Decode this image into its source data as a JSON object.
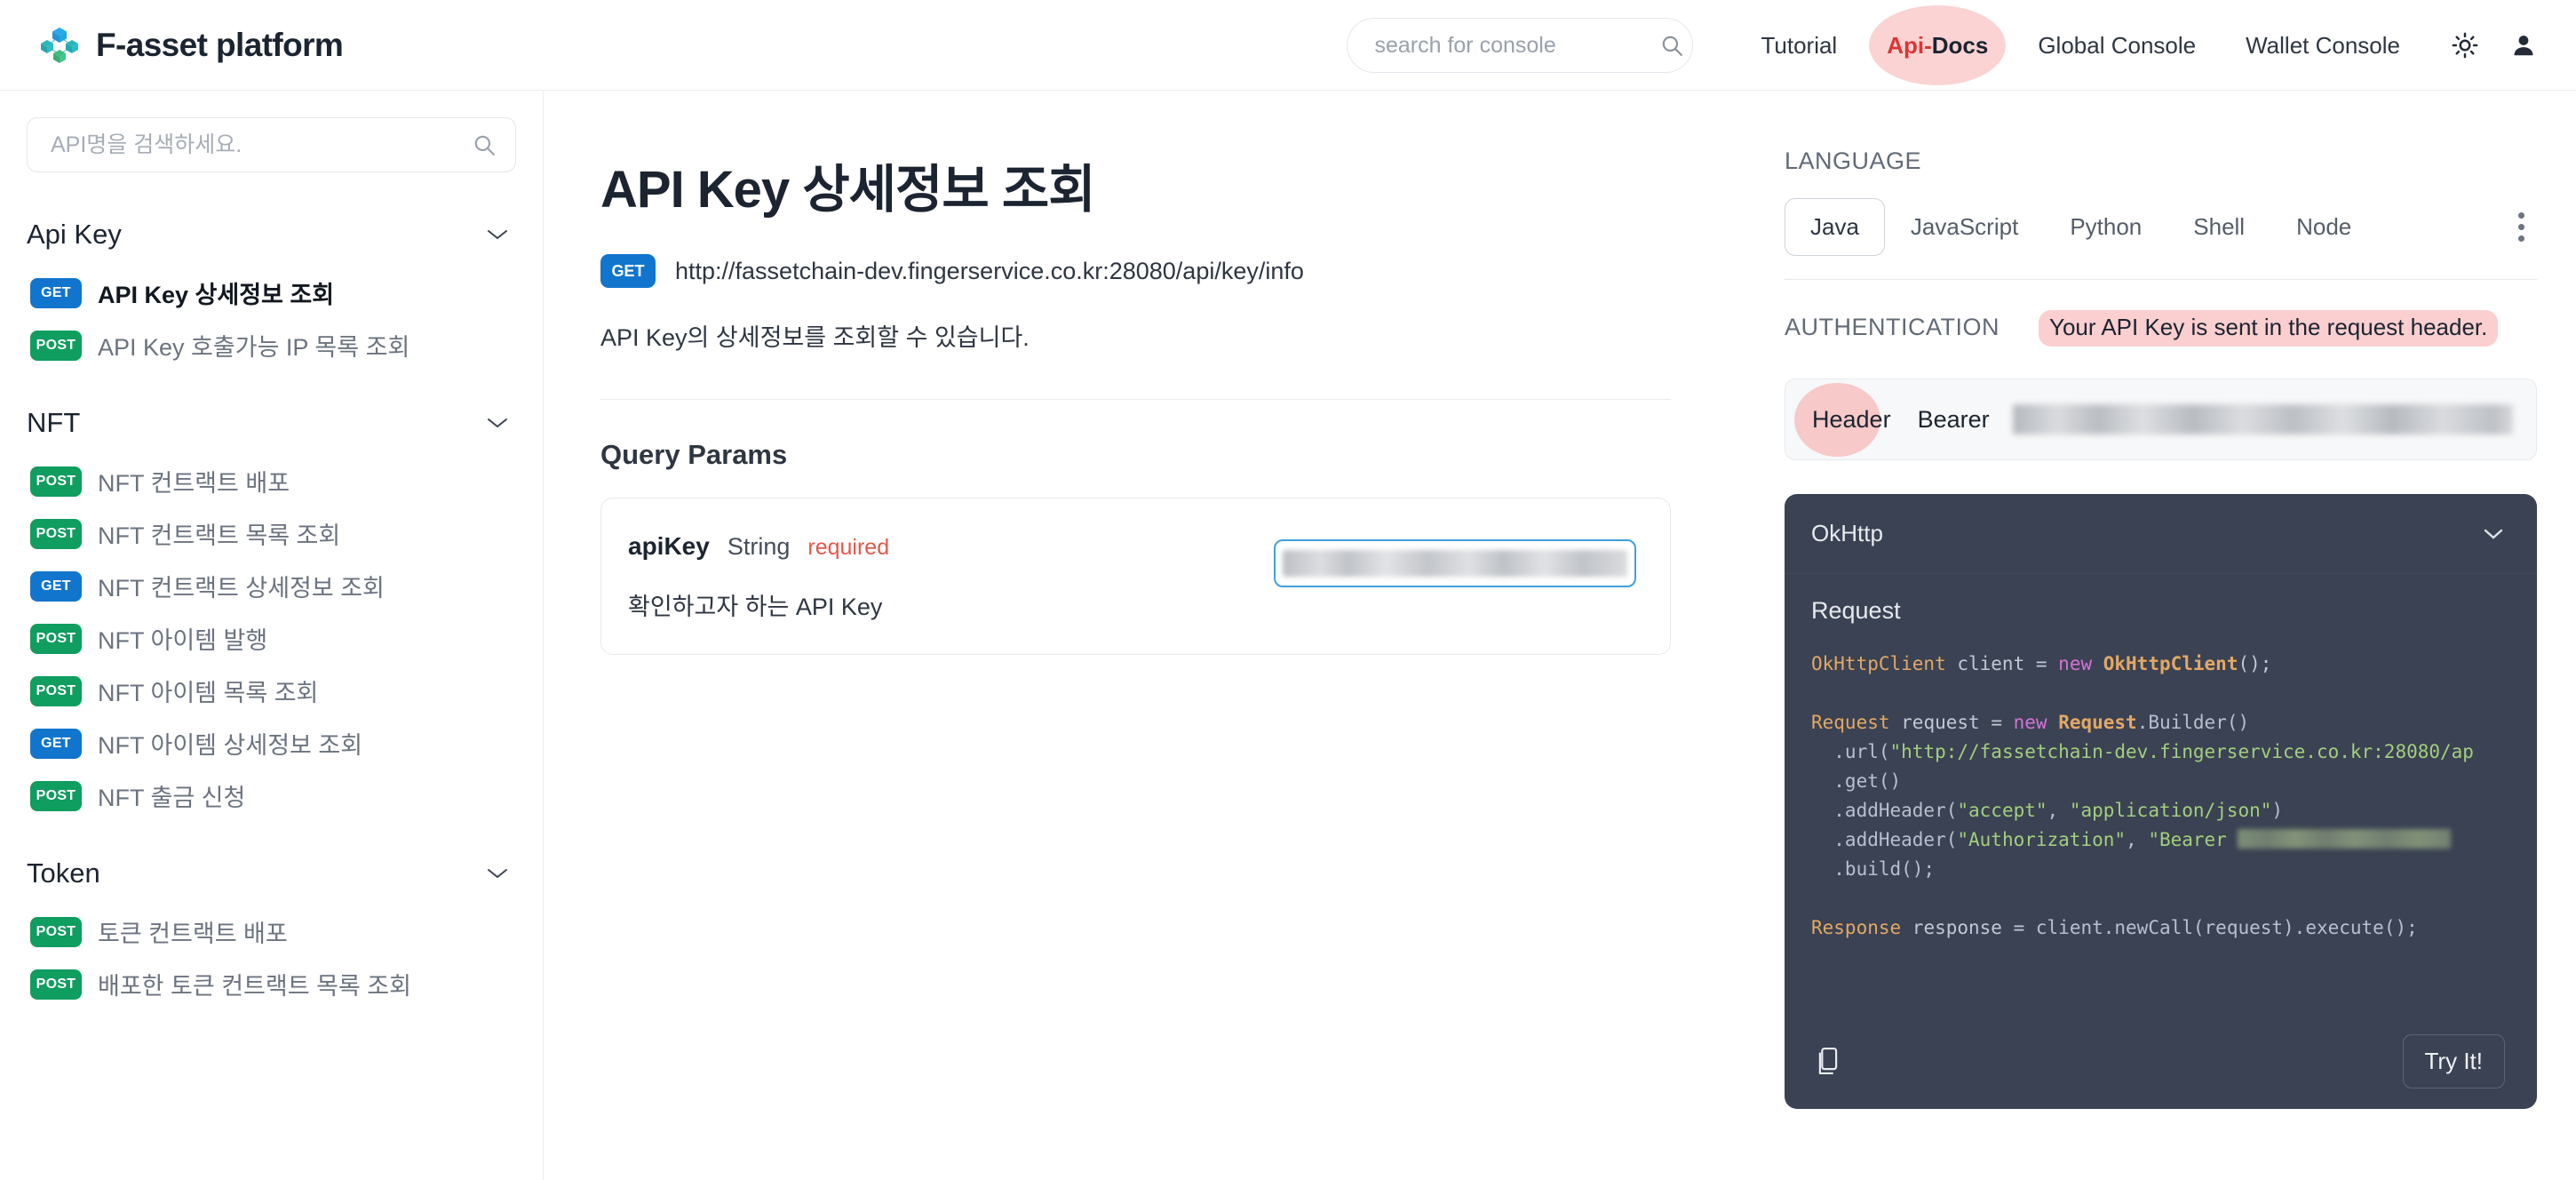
{
  "header": {
    "brand": "F-asset platform",
    "logo_colors": {
      "top": "#1fa0e8",
      "left": "#2bb2b8",
      "right": "#2bb2b8",
      "bottom": "#3fbd7e"
    },
    "search": {
      "placeholder": "search for console",
      "value": "",
      "icon": "search-icon"
    },
    "nav": [
      {
        "label": "Tutorial",
        "active": false
      },
      {
        "label": "Api-Docs",
        "active": true,
        "seg_red": "Api-",
        "seg_dark": "Docs",
        "highlight": "#fbd3d3"
      },
      {
        "label": "Global Console",
        "active": false
      },
      {
        "label": "Wallet Console",
        "active": false
      }
    ],
    "icons": [
      {
        "name": "sun-icon",
        "label": "Theme toggle"
      },
      {
        "name": "user-icon",
        "label": "Account"
      }
    ]
  },
  "sidebar": {
    "search": {
      "placeholder": "API명을 검색하세요.",
      "value": "",
      "icon": "search-icon"
    },
    "groups": [
      {
        "title": "Api Key",
        "expanded": true,
        "items": [
          {
            "method": "GET",
            "label": "API Key 상세정보 조회",
            "selected": true
          },
          {
            "method": "POST",
            "label": "API Key 호출가능 IP 목록 조회",
            "selected": false
          }
        ]
      },
      {
        "title": "NFT",
        "expanded": true,
        "items": [
          {
            "method": "POST",
            "label": "NFT 컨트랙트 배포",
            "selected": false
          },
          {
            "method": "POST",
            "label": "NFT 컨트랙트 목록 조회",
            "selected": false
          },
          {
            "method": "GET",
            "label": "NFT 컨트랙트 상세정보 조회",
            "selected": false
          },
          {
            "method": "POST",
            "label": "NFT 아이템 발행",
            "selected": false
          },
          {
            "method": "POST",
            "label": "NFT 아이템 목록 조회",
            "selected": false
          },
          {
            "method": "GET",
            "label": "NFT 아이템 상세정보 조회",
            "selected": false
          },
          {
            "method": "POST",
            "label": "NFT 출금 신청",
            "selected": false
          }
        ]
      },
      {
        "title": "Token",
        "expanded": true,
        "items": [
          {
            "method": "POST",
            "label": "토큰 컨트랙트 배포",
            "selected": false
          },
          {
            "method": "POST",
            "label": "배포한 토큰 컨트랙트 목록 조회",
            "selected": false
          }
        ]
      }
    ],
    "badge_colors": {
      "get": "#1275cd",
      "post": "#0f9d60"
    }
  },
  "main": {
    "title": "API Key 상세정보 조회",
    "method": "GET",
    "url": "http://fassetchain-dev.fingerservice.co.kr:28080/api/key/info",
    "description": "API Key의 상세정보를 조회할 수 있습니다.",
    "params_section_title": "Query Params",
    "params": [
      {
        "name": "apiKey",
        "type": "String",
        "required_label": "required",
        "description": "확인하고자 하는 API Key",
        "input_value": "",
        "input_redacted": true,
        "focus_color": "#3fa0e0"
      }
    ]
  },
  "right": {
    "language_label": "LANGUAGE",
    "languages": [
      {
        "label": "Java",
        "active": true
      },
      {
        "label": "JavaScript",
        "active": false
      },
      {
        "label": "Python",
        "active": false
      },
      {
        "label": "Shell",
        "active": false
      },
      {
        "label": "Node",
        "active": false
      }
    ],
    "more_icon": "kebab-menu-icon",
    "auth_label": "AUTHENTICATION",
    "auth_note": "Your API Key is sent in the request header.",
    "auth_note_highlight": "#fbcfcf",
    "auth_location": "Header",
    "auth_scheme": "Bearer",
    "auth_token_redacted": true,
    "code": {
      "client_label": "OkHttp",
      "collapse_icon": "chevron-down-icon",
      "section_label": "Request",
      "copy_icon": "copy-icon",
      "try_label": "Try It!",
      "background": "#3a4253",
      "lines": [
        [
          {
            "t": "type",
            "s": "OkHttpClient"
          },
          {
            "t": "plain",
            "s": " client "
          },
          {
            "t": "plain",
            "s": "= "
          },
          {
            "t": "kw",
            "s": "new "
          },
          {
            "t": "cls",
            "s": "OkHttpClient"
          },
          {
            "t": "plain",
            "s": "();"
          }
        ],
        [],
        [
          {
            "t": "type",
            "s": "Request"
          },
          {
            "t": "plain",
            "s": " request "
          },
          {
            "t": "plain",
            "s": "= "
          },
          {
            "t": "kw",
            "s": "new "
          },
          {
            "t": "cls",
            "s": "Request"
          },
          {
            "t": "fn",
            "s": ".Builder()"
          }
        ],
        [
          {
            "t": "fn",
            "s": "  .url("
          },
          {
            "t": "str",
            "s": "\"http://fassetchain-dev.fingerservice.co.kr:28080/ap"
          }
        ],
        [
          {
            "t": "fn",
            "s": "  .get()"
          }
        ],
        [
          {
            "t": "fn",
            "s": "  .addHeader("
          },
          {
            "t": "str",
            "s": "\"accept\""
          },
          {
            "t": "fn",
            "s": ", "
          },
          {
            "t": "str",
            "s": "\"application/json\""
          },
          {
            "t": "fn",
            "s": ")"
          }
        ],
        [
          {
            "t": "fn",
            "s": "  .addHeader("
          },
          {
            "t": "str",
            "s": "\"Authorization\""
          },
          {
            "t": "fn",
            "s": ", "
          },
          {
            "t": "str",
            "s": "\"Bearer "
          },
          {
            "t": "redact",
            "s": ""
          }
        ],
        [
          {
            "t": "fn",
            "s": "  .build();"
          }
        ],
        [],
        [
          {
            "t": "type",
            "s": "Response"
          },
          {
            "t": "plain",
            "s": " response "
          },
          {
            "t": "plain",
            "s": "= "
          },
          {
            "t": "fn",
            "s": "client.newCall(request).execute();"
          }
        ]
      ]
    }
  }
}
